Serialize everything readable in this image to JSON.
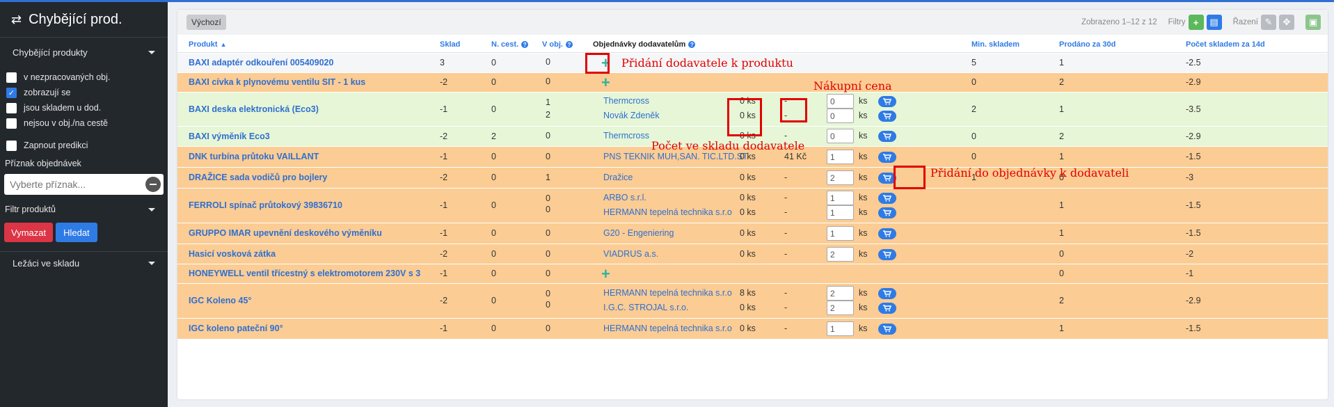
{
  "sidebar": {
    "title": "Chybějící prod.",
    "section1": "Chybějící produkty",
    "checkboxes": [
      {
        "label": "v nezpracovaných obj.",
        "checked": false
      },
      {
        "label": "zobrazují se",
        "checked": true
      },
      {
        "label": "jsou skladem u dod.",
        "checked": false
      },
      {
        "label": "nejsou v obj./na cestě",
        "checked": false
      }
    ],
    "prediction_label": "Zapnout predikci",
    "order_flag_label": "Příznak objednávek",
    "order_flag_placeholder": "Vyberte příznak...",
    "filter_label": "Filtr produktů",
    "clear_btn": "Vymazat",
    "search_btn": "Hledat",
    "section2": "Ležáci ve skladu"
  },
  "toolbar": {
    "preset": "Výchozí",
    "shown": "Zobrazeno 1–12 z 12",
    "filters_label": "Filtry",
    "sort_label": "Řazení"
  },
  "columns": {
    "product": "Produkt",
    "stock": "Sklad",
    "in_transit": "N. cest.",
    "in_order": "V obj.",
    "supplier_orders": "Objednávky dodavatelům",
    "min_stock": "Min. skladem",
    "sold_30d": "Prodáno za 30d",
    "stock_14d": "Počet skladem za 14d"
  },
  "rows": [
    {
      "name": "BAXI adaptér odkouření 005409020",
      "stock": "3",
      "transit": "0",
      "orders": [
        "0"
      ],
      "suppliers": [],
      "min": "5",
      "sold": "1",
      "d14": "-2.5"
    },
    {
      "name": "BAXI cívka k plynovému ventilu SIT - 1 kus",
      "stock": "-2",
      "transit": "0",
      "orders": [
        "0"
      ],
      "suppliers": [],
      "min": "0",
      "sold": "2",
      "d14": "-2.9"
    },
    {
      "name": "BAXI deska elektronická (Eco3)",
      "stock": "-1",
      "transit": "0",
      "orders": [
        "1",
        "2"
      ],
      "suppliers": [
        {
          "name": "Thermcross",
          "qty": "0 ks",
          "price": "-",
          "input": "0"
        },
        {
          "name": "Novák Zdeněk",
          "qty": "0 ks",
          "price": "-",
          "input": "0"
        }
      ],
      "min": "2",
      "sold": "1",
      "d14": "-3.5"
    },
    {
      "name": "BAXI výměník Eco3",
      "stock": "-2",
      "transit": "2",
      "orders": [
        "0"
      ],
      "suppliers": [
        {
          "name": "Thermcross",
          "qty": "0 ks",
          "price": "-",
          "input": "0"
        }
      ],
      "min": "0",
      "sold": "2",
      "d14": "-2.9"
    },
    {
      "name": "DNK turbína průtoku VAILLANT",
      "stock": "-1",
      "transit": "0",
      "orders": [
        "0"
      ],
      "suppliers": [
        {
          "name": "PNS TEKNIK MUH,SAN. TIC.LTD.ST",
          "qty": "0 ks",
          "price": "41 Kč",
          "input": "1"
        }
      ],
      "min": "0",
      "sold": "1",
      "d14": "-1.5"
    },
    {
      "name": "DRAŽICE sada vodičů pro bojlery",
      "stock": "-2",
      "transit": "0",
      "orders": [
        "1"
      ],
      "suppliers": [
        {
          "name": "Dražice",
          "qty": "0 ks",
          "price": "-",
          "input": "2"
        }
      ],
      "min": "1",
      "sold": "0",
      "d14": "-3"
    },
    {
      "name": "FERROLI spínač průtokový 39836710",
      "stock": "-1",
      "transit": "0",
      "orders": [
        "0",
        "0"
      ],
      "suppliers": [
        {
          "name": "ARBO s.r.l.",
          "qty": "0 ks",
          "price": "-",
          "input": "1"
        },
        {
          "name": "HERMANN tepelná technika s.r.o",
          "qty": "0 ks",
          "price": "-",
          "input": "1"
        }
      ],
      "min": "",
      "sold": "1",
      "d14": "-1.5"
    },
    {
      "name": "GRUPPO IMAR upevnění deskového výměníku",
      "stock": "-1",
      "transit": "0",
      "orders": [
        "0"
      ],
      "suppliers": [
        {
          "name": "G20 - Engeniering",
          "qty": "0 ks",
          "price": "-",
          "input": "1"
        }
      ],
      "min": "",
      "sold": "1",
      "d14": "-1.5"
    },
    {
      "name": "Hasicí vosková zátka",
      "stock": "-2",
      "transit": "0",
      "orders": [
        "0"
      ],
      "suppliers": [
        {
          "name": "VIADRUS a.s.",
          "qty": "0 ks",
          "price": "-",
          "input": "2"
        }
      ],
      "min": "",
      "sold": "0",
      "d14": "-2"
    },
    {
      "name": "HONEYWELL ventil třícestný s elektromotorem 230V s 3",
      "stock": "-1",
      "transit": "0",
      "orders": [
        "0"
      ],
      "suppliers": [],
      "min": "",
      "sold": "0",
      "d14": "-1"
    },
    {
      "name": "IGC Koleno 45°",
      "stock": "-2",
      "transit": "0",
      "orders": [
        "0",
        "0"
      ],
      "suppliers": [
        {
          "name": "HERMANN tepelná technika s.r.o",
          "qty": "8 ks",
          "price": "-",
          "input": "2"
        },
        {
          "name": "I.G.C. STROJAL s.r.o.",
          "qty": "0 ks",
          "price": "-",
          "input": "2"
        }
      ],
      "min": "",
      "sold": "2",
      "d14": "-2.9"
    },
    {
      "name": "IGC koleno pateční 90°",
      "stock": "-1",
      "transit": "0",
      "orders": [
        "0"
      ],
      "suppliers": [
        {
          "name": "HERMANN tepelná technika s.r.o",
          "qty": "0 ks",
          "price": "-",
          "input": "1"
        }
      ],
      "min": "",
      "sold": "1",
      "d14": "-1.5"
    }
  ],
  "unit": "ks",
  "annotations": {
    "add_supplier": "Přidání dodavatele k produktu",
    "purchase_price": "Nákupní cena",
    "supplier_stock": "Počet ve skladu dodavatele",
    "add_to_order": "Přidání do objednávky k dodavateli"
  },
  "colors": {
    "accent": "#2f7be5",
    "row_orange": "#fbcc93",
    "row_green": "#e6f6d6",
    "annotation": "#e10000"
  }
}
